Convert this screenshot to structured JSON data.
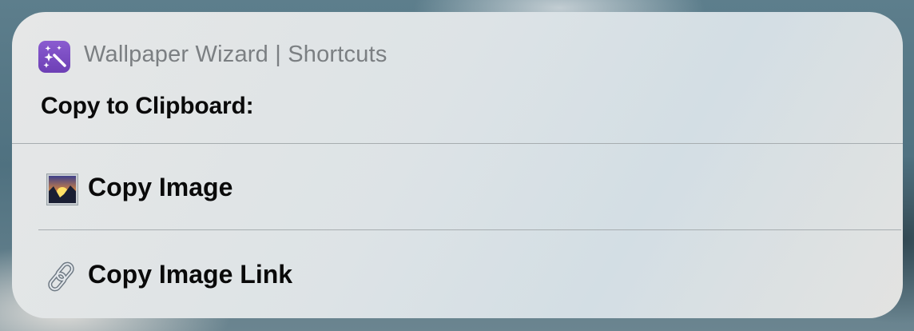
{
  "app": {
    "title": "Wallpaper Wizard | Shortcuts",
    "icon": "magic-wand-sparkles-icon",
    "icon_color": "#7a4cc4"
  },
  "prompt": "Copy to Clipboard:",
  "options": [
    {
      "label": "Copy Image",
      "icon": "sunrise-over-mountains-icon"
    },
    {
      "label": "Copy Image Link",
      "icon": "link-icon"
    }
  ]
}
